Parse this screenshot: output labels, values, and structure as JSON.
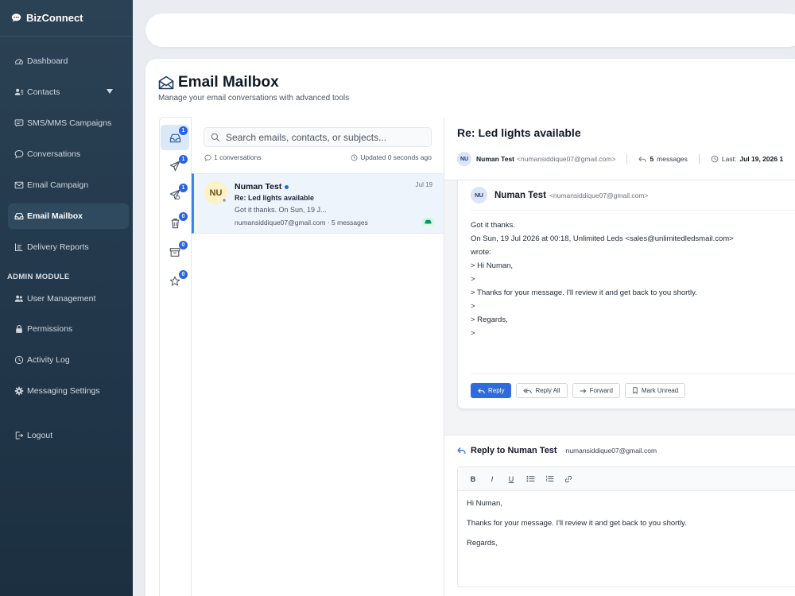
{
  "app": {
    "name": "BizConnect"
  },
  "sidebar": {
    "items": [
      {
        "label": "Dashboard",
        "icon": "dashboard-icon"
      },
      {
        "label": "Contacts",
        "icon": "contacts-icon",
        "has_submenu": true
      },
      {
        "label": "SMS/MMS Campaigns",
        "icon": "sms-icon"
      },
      {
        "label": "Conversations",
        "icon": "chat-icon"
      },
      {
        "label": "Email Campaign",
        "icon": "envelope-icon"
      },
      {
        "label": "Email Mailbox",
        "icon": "inbox-icon",
        "active": true
      },
      {
        "label": "Delivery Reports",
        "icon": "reports-icon"
      }
    ],
    "admin_section_label": "ADMIN MODULE",
    "admin_items": [
      {
        "label": "User Management",
        "icon": "users-icon"
      },
      {
        "label": "Permissions",
        "icon": "lock-icon"
      },
      {
        "label": "Activity Log",
        "icon": "clock-icon"
      },
      {
        "label": "Messaging Settings",
        "icon": "gear-icon"
      }
    ],
    "logout_label": "Logout"
  },
  "page": {
    "title": "Email Mailbox",
    "subtitle": "Manage your email conversations with advanced tools"
  },
  "folders": [
    {
      "icon": "inbox-icon",
      "count": "1",
      "active": true
    },
    {
      "icon": "send-icon",
      "count": "1"
    },
    {
      "icon": "scheduled-send-icon",
      "count": "1"
    },
    {
      "icon": "trash-icon",
      "count": "0"
    },
    {
      "icon": "archive-icon",
      "count": "0"
    },
    {
      "icon": "star-icon",
      "count": "0"
    }
  ],
  "list": {
    "search_placeholder": "Search emails, contacts, or subjects...",
    "count_text": "1 conversations",
    "updated_text": "Updated 0 seconds ago",
    "conversations": [
      {
        "initials": "NU",
        "name": "Numan Test",
        "date": "Jul 19",
        "subject": "Re: Led lights available",
        "preview": "Got it thanks. On Sun, 19 J...",
        "meta": "numansiddique07@gmail.com · 5 messages"
      }
    ]
  },
  "reader": {
    "subject": "Re: Led lights available",
    "from_initials": "NU",
    "from_name": "Numan Test",
    "from_email": "<numansiddique07@gmail.com>",
    "messages_count": "5",
    "messages_label": "messages",
    "last_label": "Last:",
    "last_value": "Jul 19, 2026 1",
    "message": {
      "initials": "NU",
      "name": "Numan Test",
      "email": "<numansiddique07@gmail.com>",
      "body": [
        "Got it thanks.",
        "",
        "On Sun, 19 Jul 2026 at 00:18, Unlimited Leds <sales@unlimitedledsmail.com>",
        "wrote:",
        "",
        "> Hi Numan,",
        ">",
        "> Thanks for your message. I'll review it and get back to you shortly.",
        ">",
        "> Regards,",
        ">"
      ]
    },
    "actions": {
      "reply": "Reply",
      "reply_all": "Reply All",
      "forward": "Forward",
      "mark_unread": "Mark Unread"
    }
  },
  "reply": {
    "title": "Reply to Numan Test",
    "email": "numansiddique07@gmail.com",
    "toolbar": {
      "bold": "B",
      "italic": "I",
      "underline": "U"
    },
    "body": [
      "Hi Numan,",
      "Thanks for your message. I'll review it and get back to you shortly.",
      "Regards,"
    ]
  },
  "colors": {
    "sidebar_bg": "#22384a",
    "accent": "#2563eb",
    "active_row": "#eef4fc"
  }
}
